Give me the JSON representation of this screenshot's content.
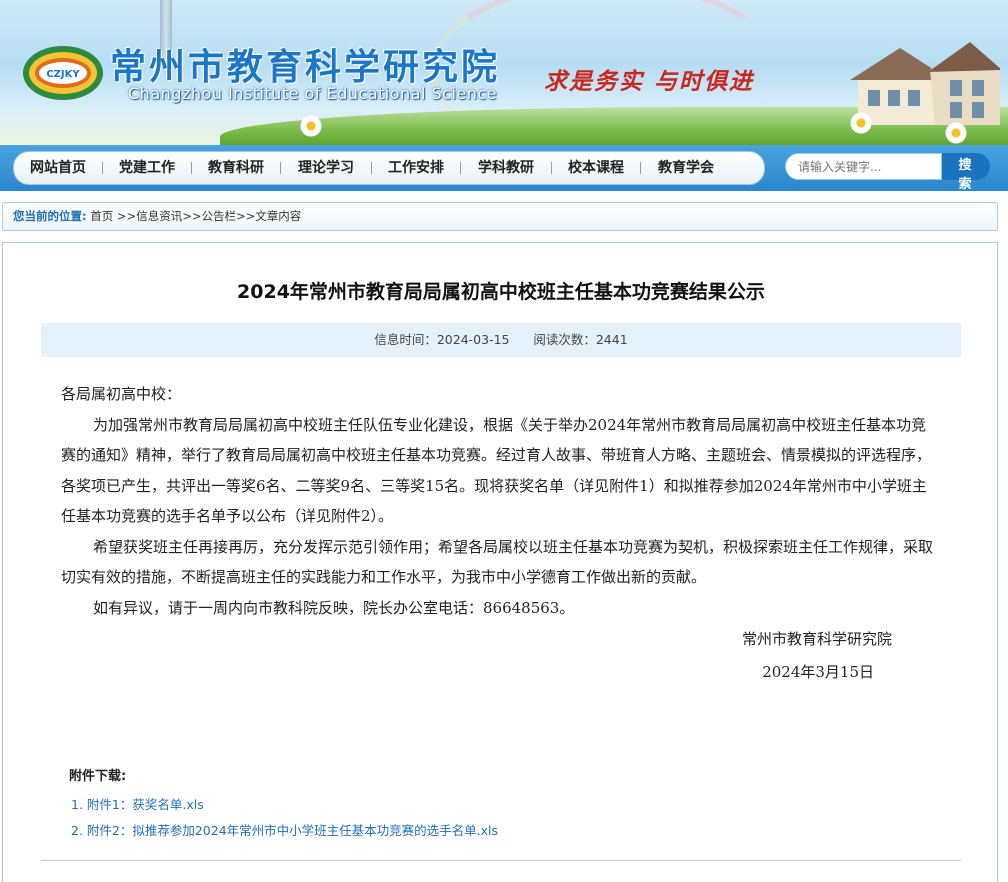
{
  "header": {
    "logo_text": "CZJKY",
    "title": "常州市教育科学研究院",
    "subtitle": "Changzhou Institute of Educational Science",
    "slogan": "求是务实  与时俱进"
  },
  "nav": {
    "items": [
      {
        "label": "网站首页"
      },
      {
        "label": "党建工作"
      },
      {
        "label": "教育科研"
      },
      {
        "label": "理论学习"
      },
      {
        "label": "工作安排"
      },
      {
        "label": "学科教研"
      },
      {
        "label": "校本课程"
      },
      {
        "label": "教育学会"
      }
    ],
    "search_placeholder": "请输入关键字...",
    "search_button": "搜 索"
  },
  "breadcrumb": {
    "lead": "您当前的位置:",
    "items": [
      "首页",
      "信息资讯",
      "公告栏",
      "文章内容"
    ],
    "separator": ">>"
  },
  "article": {
    "title": "2024年常州市教育局局属初高中校班主任基本功竞赛结果公示",
    "info_time_label": "信息时间：2024-03-15",
    "info_views_label": "阅读次数：2441",
    "greeting": "各局属初高中校：",
    "paragraphs": [
      "为加强常州市教育局局属初高中校班主任队伍专业化建设，根据《关于举办2024年常州市教育局局属初高中校班主任基本功竞赛的通知》精神，举行了教育局局属初高中校班主任基本功竞赛。经过育人故事、带班育人方略、主题班会、情景模拟的评选程序，各奖项已产生，共评出一等奖6名、二等奖9名、三等奖15名。现将获奖名单（详见附件1）和拟推荐参加2024年常州市中小学班主任基本功竞赛的选手名单予以公布（详见附件2）。",
      "希望获奖班主任再接再厉，充分发挥示范引领作用；希望各局属校以班主任基本功竞赛为契机，积极探索班主任工作规律，采取切实有效的措施，不断提高班主任的实践能力和工作水平，为我市中小学德育工作做出新的贡献。",
      "如有异议，请于一周内向市教科院反映，院长办公室电话：86648563。"
    ],
    "signature_org": "常州市教育科学研究院",
    "signature_date": "2024年3月15日"
  },
  "attachments": {
    "heading": "附件下载:",
    "items": [
      {
        "label": "1. 附件1：获奖名单.xls"
      },
      {
        "label": "2. 附件2：拟推荐参加2024年常州市中小学班主任基本功竞赛的选手名单.xls"
      }
    ]
  },
  "colors": {
    "brand_blue": "#1b76c6",
    "slogan_red": "#c9261e",
    "link_blue": "#1f6fb5",
    "info_bar_bg": "#e5f1fa"
  }
}
